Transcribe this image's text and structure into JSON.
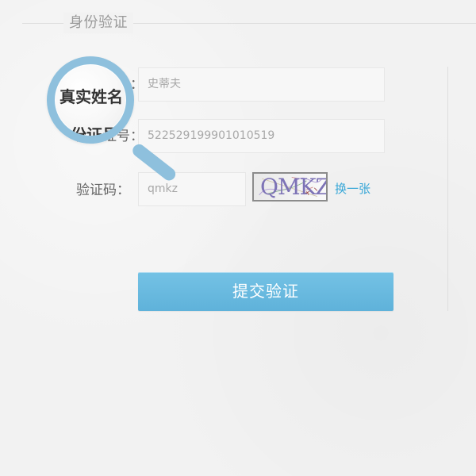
{
  "section": {
    "title": "身份验证"
  },
  "form": {
    "name_label": "真实姓名：",
    "name_value": "史蒂夫",
    "id_label": "身份证号：",
    "id_value": "522529199901010519",
    "captcha_label": "验证码：",
    "captcha_value": "qmkz",
    "captcha_text": "QMKZ",
    "refresh_label": "换一张",
    "submit_label": "提交验证"
  },
  "magnifier": {
    "top_text": "真实姓名",
    "bottom_text": "身份证号"
  },
  "icons": {
    "magnifier": "magnifier-icon"
  },
  "colors": {
    "accent": "#5fb2da",
    "link": "#38a7d7",
    "lens": "#8ec0dd",
    "border": "#e7e7e7"
  }
}
